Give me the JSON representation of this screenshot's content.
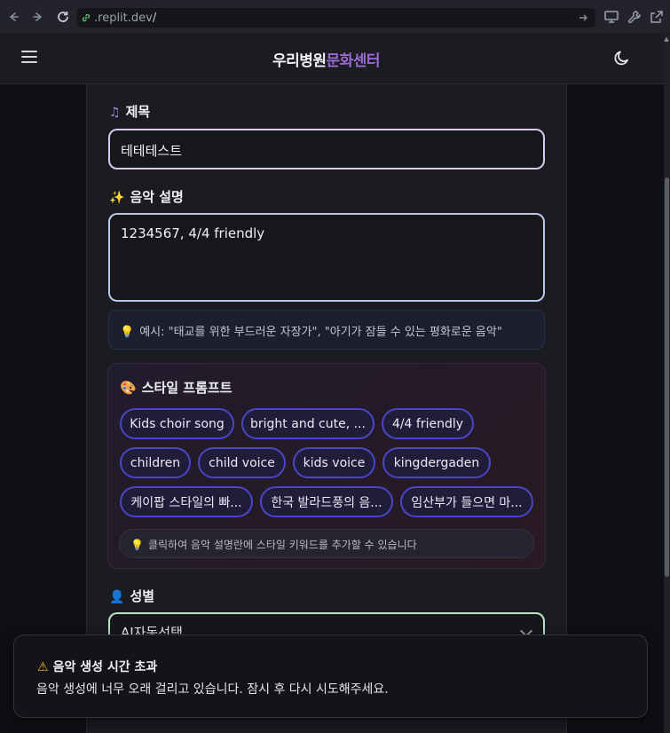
{
  "browser": {
    "url_domain": ".replit.dev",
    "url_path": "/"
  },
  "header": {
    "brand_part1": "우리병원",
    "brand_part2": "문화센터"
  },
  "form": {
    "title_label": "제목",
    "title_value": "테테테스트",
    "description_label": "음악 설명",
    "description_value": "1234567, 4/4 friendly",
    "example_hint": "예시: \"태교를 위한 부드러운 자장가\", \"아기가 잠들 수 있는 평화로운 음악\"",
    "style_prompt_label": "스타일 프롬프트",
    "style_chips": [
      "Kids choir song",
      "bright and cute, ...",
      "4/4 friendly",
      "children",
      "child voice",
      "kids voice",
      "kingdergaden",
      "케이팝 스타일의 빠...",
      "한국 발라드풍의 음...",
      "임산부가 들으면 마..."
    ],
    "style_hint": "클릭하여 음악 설명란에 스타일 키워드를 추가할 수 있습니다",
    "gender_label": "성별",
    "gender_value": "AI자동선택"
  },
  "toast": {
    "title": "음악 생성 시간 초과",
    "description": "음악 생성에 너무 오래 걸리고 있습니다. 잠시 후 다시 시도해주세요."
  },
  "icons": {
    "title_icon": "music-note-icon",
    "description_icon": "sparkles-icon",
    "hint_icon": "lightbulb-icon",
    "style_icon": "palette-icon",
    "gender_icon": "person-icon",
    "toast_icon": "warning-icon"
  },
  "colors": {
    "brand_accent": "#9b6ad8",
    "chip_border": "#4b45c9",
    "title_input_border": "#d8c8ee",
    "gender_input_border": "#b9e8c9"
  }
}
